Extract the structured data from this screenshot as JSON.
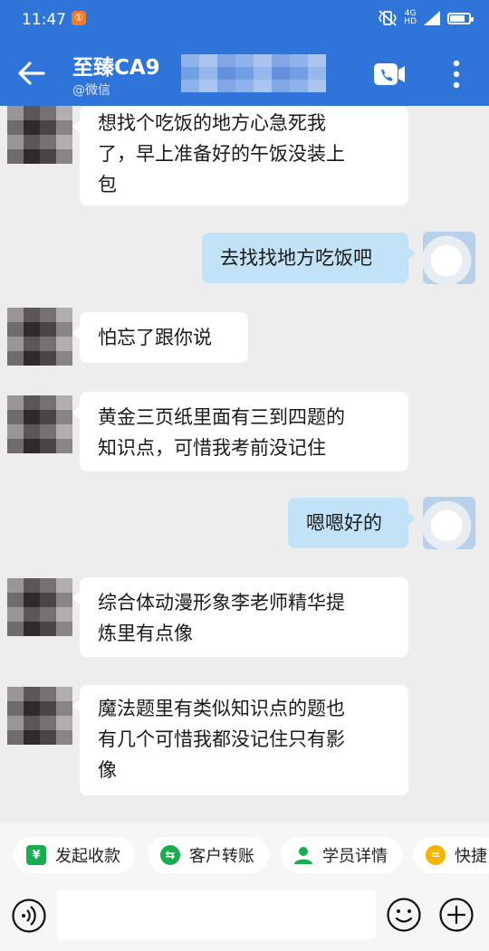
{
  "status_bar": {
    "time": "11:47",
    "notification_badge": "①",
    "network": "4G",
    "network_sub": "HD"
  },
  "header": {
    "title": "至臻CA9",
    "subtitle": "@微信",
    "back_icon": "arrow-left-icon",
    "video_icon": "video-call-icon",
    "more_icon": "more-vertical-icon"
  },
  "messages": [
    {
      "side": "left",
      "text_lines": [
        "想找个吃饭的地方心急死我",
        "了，早上准备好的午饭没装上",
        "包"
      ]
    },
    {
      "side": "right",
      "text_lines": [
        "去找找地方吃饭吧"
      ]
    },
    {
      "side": "left",
      "text_lines": [
        "怕忘了跟你说"
      ]
    },
    {
      "side": "left",
      "text_lines": [
        "黄金三页纸里面有三到四题的",
        "知识点，可惜我考前没记住"
      ]
    },
    {
      "side": "right",
      "text_lines": [
        "嗯嗯好的"
      ]
    },
    {
      "side": "left",
      "text_lines": [
        "综合体动漫形象李老师精华提",
        "炼里有点像"
      ]
    },
    {
      "side": "left",
      "text_lines": [
        "魔法题里有类似知识点的题也",
        "有几个可惜我都没记住只有影",
        "像"
      ]
    }
  ],
  "quick_actions": [
    {
      "label": "发起收款",
      "icon": "yuan-icon",
      "color": "#1aad4f"
    },
    {
      "label": "客户转账",
      "icon": "transfer-icon",
      "color": "#1aad4f"
    },
    {
      "label": "学员详情",
      "icon": "user-icon",
      "color": "#1aad4f"
    },
    {
      "label": "快捷",
      "icon": "menu-icon",
      "color": "#f5b400"
    }
  ],
  "input": {
    "placeholder": ""
  },
  "colors": {
    "header_bg": "#2f74d8",
    "chat_bg": "#ededed",
    "my_bubble": "#c2e2f7"
  }
}
